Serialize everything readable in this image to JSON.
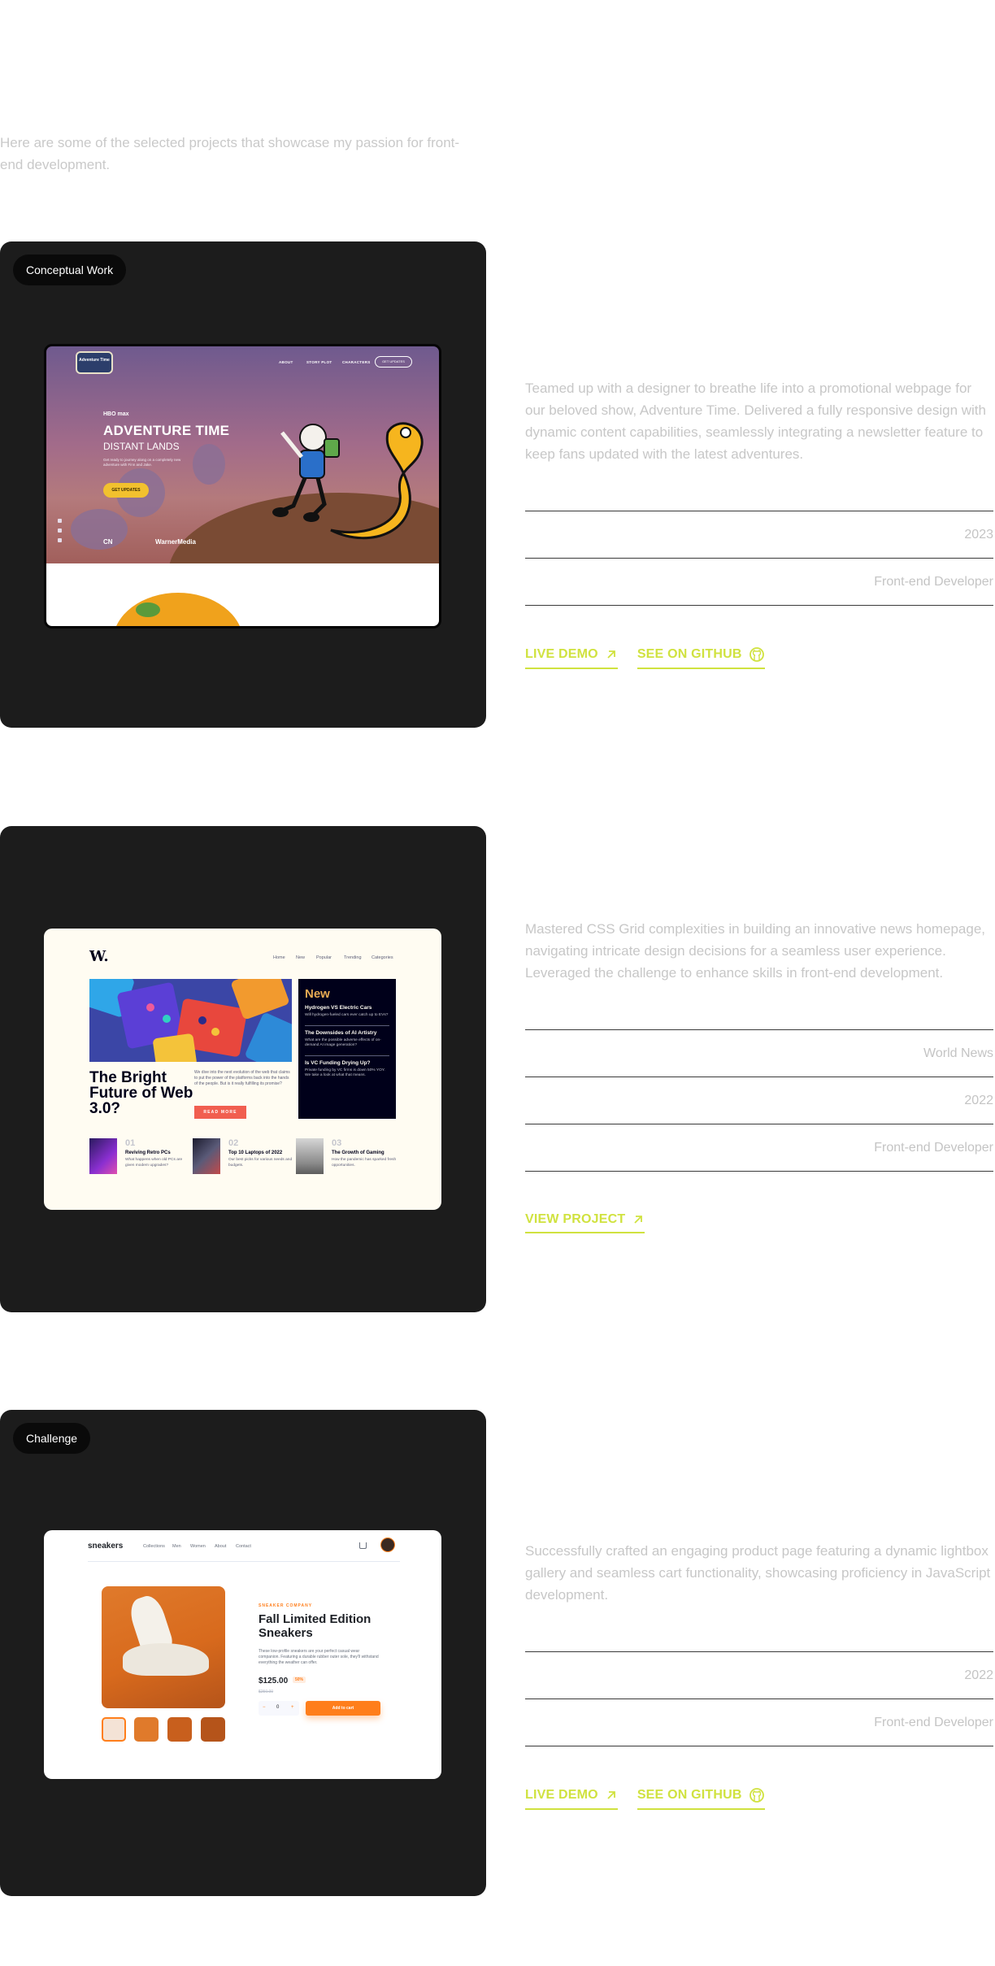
{
  "intro": "Here are some of the selected projects that showcase my passion for front-end development.",
  "colors": {
    "accent": "#d0e23f",
    "card": "#1c1c1c",
    "muted_text": "#c6c6c6"
  },
  "projects": [
    {
      "tag": "Conceptual Work",
      "description": "Teamed up with a designer to breathe life into a promotional webpage for our beloved show, Adventure Time. Delivered a fully responsive design with dynamic content capabilities, seamlessly integrating a newsletter feature to keep fans updated with the latest adventures.",
      "year": "2023",
      "role": "Front-end Developer",
      "links": [
        {
          "label": "LIVE DEMO",
          "icon": "arrow-up-right-icon"
        },
        {
          "label": "SEE ON GITHUB",
          "icon": "github-icon"
        }
      ],
      "mock": {
        "logo": "Adventure Time",
        "nav": [
          "ABOUT",
          "STORY PLOT",
          "CHARACTERS"
        ],
        "nav_button": "GET UPDATES",
        "brand": "HBO max",
        "title": "ADVENTURE TIME",
        "subtitle": "DISTANT LANDS",
        "blurb": "Get ready to journey along on a completely new adventure with Finn and Jake.",
        "cta": "GET UPDATES",
        "partner_logos": [
          "CN",
          "WarnerMedia"
        ]
      }
    },
    {
      "tag": "",
      "description": "Mastered CSS Grid complexities in building an innovative news homepage, navigating intricate design decisions for a seamless user experience. Leveraged the challenge to enhance skills in  front-end development.",
      "client": "World News",
      "year": "2022",
      "role": "Front-end Developer",
      "links": [
        {
          "label": "VIEW PROJECT",
          "icon": "arrow-up-right-icon"
        }
      ],
      "mock": {
        "logo": "W.",
        "nav": [
          "Home",
          "New",
          "Popular",
          "Trending",
          "Categories"
        ],
        "headline": "The Bright Future of Web 3.0?",
        "paragraph": "We dive into the next evolution of the web that claims to put the power of the platforms back into the hands of the people. But is it really fulfilling its promise?",
        "read_more": "READ MORE",
        "new_title": "New",
        "new_items": [
          {
            "title": "Hydrogen VS Electric Cars",
            "text": "Will hydrogen-fueled cars ever catch up to EVs?"
          },
          {
            "title": "The Downsides of AI Artistry",
            "text": "What are the possible adverse effects of on-demand AI image generation?"
          },
          {
            "title": "Is VC Funding Drying Up?",
            "text": "Private funding by VC firms is down 50% YOY. We take a look at what that means."
          }
        ],
        "bottom": [
          {
            "num": "01",
            "title": "Reviving Retro PCs",
            "text": "What happens when old PCs are given modern upgrades?"
          },
          {
            "num": "02",
            "title": "Top 10 Laptops of 2022",
            "text": "Our best picks for various needs and budgets."
          },
          {
            "num": "03",
            "title": "The Growth of Gaming",
            "text": "How the pandemic has sparked fresh opportunities."
          }
        ]
      }
    },
    {
      "tag": "Challenge",
      "description": "Successfully crafted an engaging product page featuring a dynamic lightbox gallery and seamless cart functionality, showcasing proficiency in JavaScript development.",
      "year": "2022",
      "role": "Front-end Developer",
      "links": [
        {
          "label": "LIVE DEMO",
          "icon": "arrow-up-right-icon"
        },
        {
          "label": "SEE ON GITHUB",
          "icon": "github-icon"
        }
      ],
      "mock": {
        "logo": "sneakers",
        "nav": [
          "Collections",
          "Men",
          "Women",
          "About",
          "Contact"
        ],
        "company": "SNEAKER COMPANY",
        "title": "Fall Limited Edition Sneakers",
        "description": "These low-profile sneakers are your perfect casual wear companion. Featuring a durable rubber outer sole, they'll withstand everything the weather can offer.",
        "price": "$125.00",
        "discount": "50%",
        "old_price": "$250.00",
        "quantity": "0",
        "minus": "−",
        "plus": "+",
        "add_button": "Add to cart"
      }
    }
  ]
}
